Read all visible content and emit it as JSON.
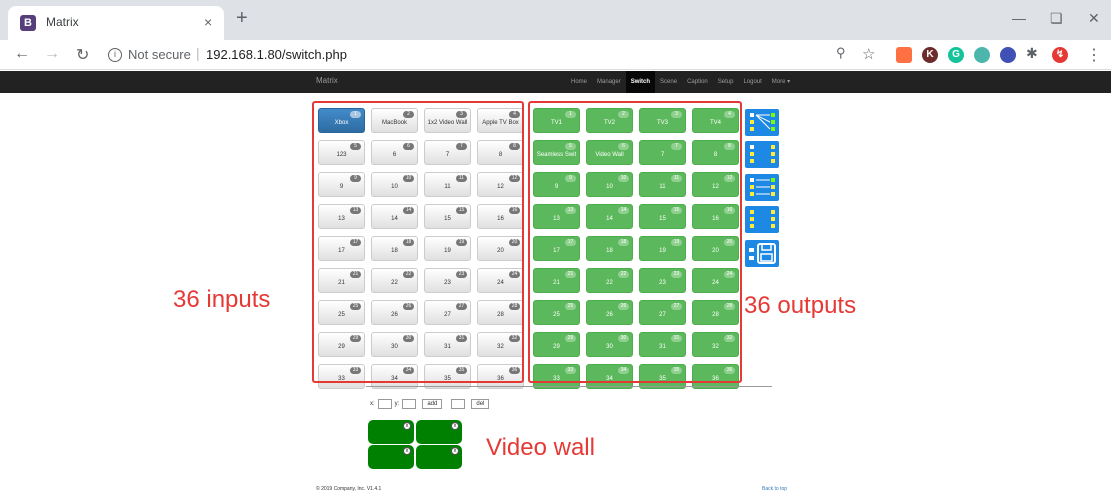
{
  "browser": {
    "tab_title": "Matrix",
    "favicon": "B",
    "new_tab": "+",
    "close_tab": "×",
    "security_label": "Not secure",
    "url": "192.168.1.80/switch.php"
  },
  "navbar": {
    "brand": "Matrix",
    "links": [
      "Home",
      "Manager",
      "Switch",
      "Scene",
      "Caption",
      "Setup",
      "Logout",
      "More ▾"
    ],
    "active": "Switch"
  },
  "inputs": [
    {
      "label": "Xbox",
      "num": "1",
      "selected": true
    },
    {
      "label": "MacBook",
      "num": "2"
    },
    {
      "label": "1x2 Video Wall",
      "num": "3"
    },
    {
      "label": "Apple TV Box",
      "num": "4"
    },
    {
      "label": "123",
      "num": "5"
    },
    {
      "label": "6",
      "num": "6"
    },
    {
      "label": "7",
      "num": "7"
    },
    {
      "label": "8",
      "num": "8"
    },
    {
      "label": "9",
      "num": "9"
    },
    {
      "label": "10",
      "num": "10"
    },
    {
      "label": "11",
      "num": "11"
    },
    {
      "label": "12",
      "num": "12"
    },
    {
      "label": "13",
      "num": "13"
    },
    {
      "label": "14",
      "num": "14"
    },
    {
      "label": "15",
      "num": "15"
    },
    {
      "label": "16",
      "num": "16"
    },
    {
      "label": "17",
      "num": "17"
    },
    {
      "label": "18",
      "num": "18"
    },
    {
      "label": "19",
      "num": "19"
    },
    {
      "label": "20",
      "num": "20"
    },
    {
      "label": "21",
      "num": "21"
    },
    {
      "label": "22",
      "num": "22"
    },
    {
      "label": "23",
      "num": "23"
    },
    {
      "label": "24",
      "num": "24"
    },
    {
      "label": "25",
      "num": "25"
    },
    {
      "label": "26",
      "num": "26"
    },
    {
      "label": "27",
      "num": "27"
    },
    {
      "label": "28",
      "num": "28"
    },
    {
      "label": "29",
      "num": "29"
    },
    {
      "label": "30",
      "num": "30"
    },
    {
      "label": "31",
      "num": "31"
    },
    {
      "label": "32",
      "num": "32"
    },
    {
      "label": "33",
      "num": "33"
    },
    {
      "label": "34",
      "num": "34"
    },
    {
      "label": "35",
      "num": "35"
    },
    {
      "label": "36",
      "num": "36"
    }
  ],
  "outputs": [
    {
      "label": "TV1",
      "num": "1"
    },
    {
      "label": "TV2",
      "num": "2"
    },
    {
      "label": "TV3",
      "num": "3"
    },
    {
      "label": "TV4",
      "num": "4"
    },
    {
      "label": "Seamless Swit",
      "num": "5"
    },
    {
      "label": "Video Wall",
      "num": "6"
    },
    {
      "label": "7",
      "num": "7"
    },
    {
      "label": "8",
      "num": "8"
    },
    {
      "label": "9",
      "num": "9"
    },
    {
      "label": "10",
      "num": "10"
    },
    {
      "label": "11",
      "num": "11"
    },
    {
      "label": "12",
      "num": "12"
    },
    {
      "label": "13",
      "num": "13"
    },
    {
      "label": "14",
      "num": "14"
    },
    {
      "label": "15",
      "num": "15"
    },
    {
      "label": "16",
      "num": "16"
    },
    {
      "label": "17",
      "num": "17"
    },
    {
      "label": "18",
      "num": "18"
    },
    {
      "label": "19",
      "num": "19"
    },
    {
      "label": "20",
      "num": "20"
    },
    {
      "label": "21",
      "num": "21"
    },
    {
      "label": "22",
      "num": "22"
    },
    {
      "label": "23",
      "num": "23"
    },
    {
      "label": "24",
      "num": "24"
    },
    {
      "label": "25",
      "num": "25"
    },
    {
      "label": "26",
      "num": "26"
    },
    {
      "label": "27",
      "num": "27"
    },
    {
      "label": "28",
      "num": "28"
    },
    {
      "label": "29",
      "num": "29"
    },
    {
      "label": "30",
      "num": "30"
    },
    {
      "label": "31",
      "num": "31"
    },
    {
      "label": "32",
      "num": "32"
    },
    {
      "label": "33",
      "num": "33"
    },
    {
      "label": "34",
      "num": "34"
    },
    {
      "label": "35",
      "num": "35"
    },
    {
      "label": "36",
      "num": "36"
    }
  ],
  "annotations": {
    "inputs": "36 inputs",
    "outputs": "36 outputs",
    "video_wall": "Video wall"
  },
  "videowall_form": {
    "x_label": "x:",
    "y_label": "y:",
    "add_label": "add",
    "del_label": "del"
  },
  "footer": {
    "copyright": "© 2019 Company, Inc. V1.4.1",
    "back_to_top": "Back to top"
  },
  "colors": {
    "input_selected": "#337ab7",
    "output": "#5cb85c",
    "annotation": "#e53935",
    "side_button": "#1e88e5",
    "video_wall_cell": "#008000"
  }
}
